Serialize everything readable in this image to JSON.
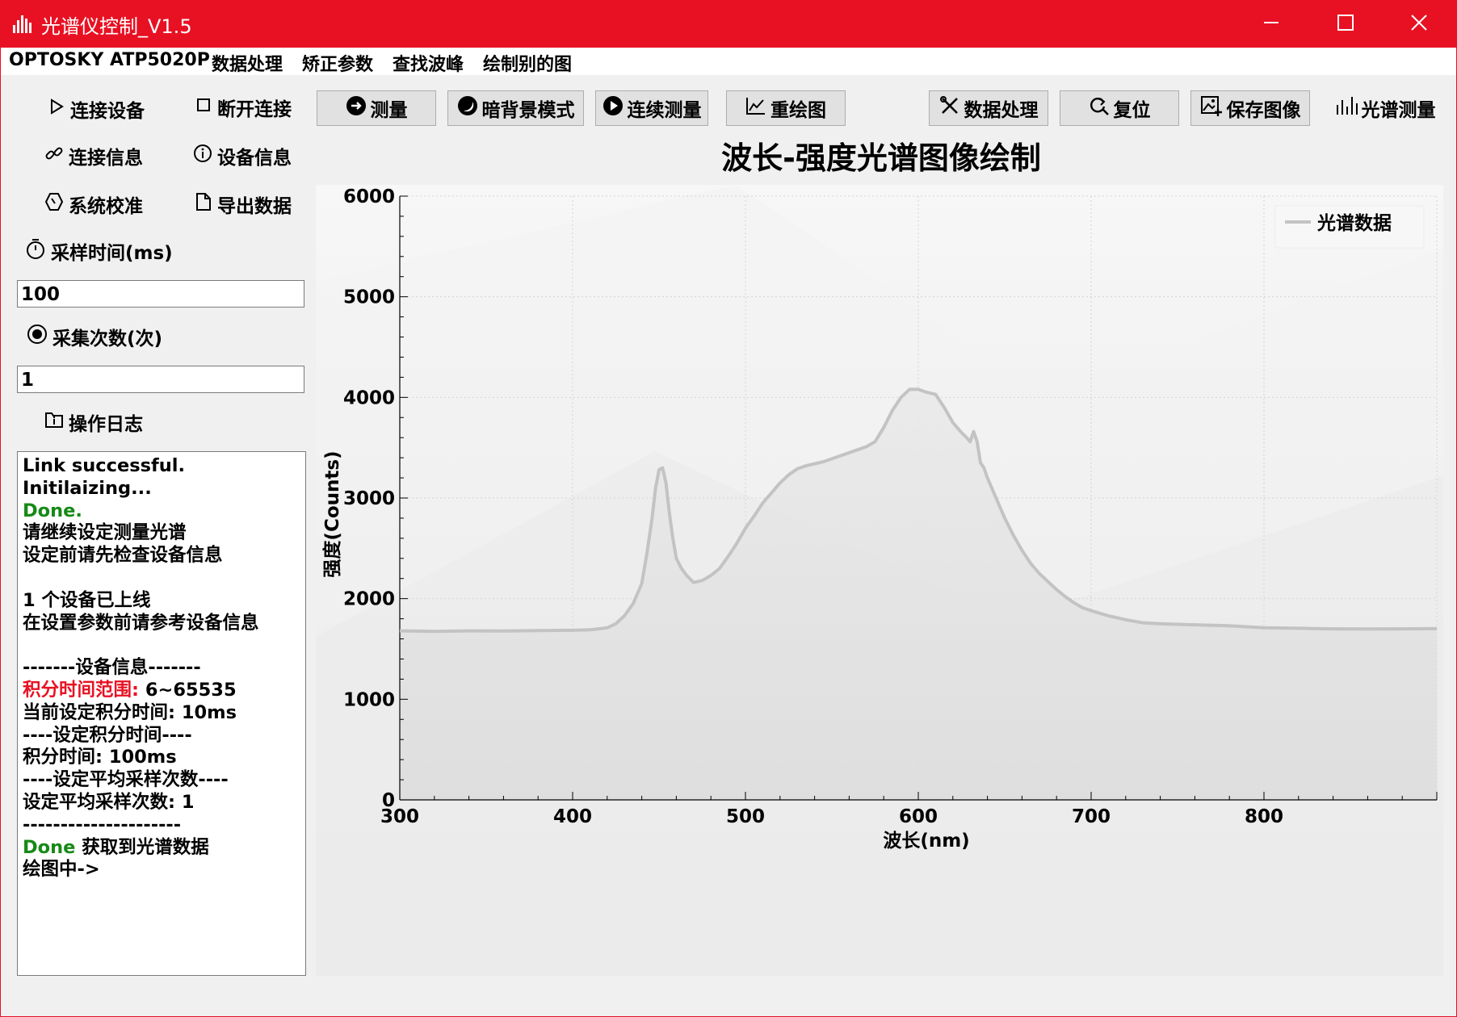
{
  "window": {
    "title": "光谱仪控制_V1.5",
    "accent": "#e81123",
    "controls": [
      "minimize-icon",
      "maximize-icon",
      "close-icon"
    ]
  },
  "menu": {
    "items": [
      "OPTOSKY ATP5020P",
      "数据处理",
      "矫正参数",
      "查找波峰",
      "绘制别的图"
    ]
  },
  "sidebar": {
    "connect": "连接设备",
    "disconnect": "断开连接",
    "link_info": "连接信息",
    "device_info": "设备信息",
    "calibrate": "系统校准",
    "export": "导出数据",
    "sample_time_label": "采样时间(ms)",
    "sample_time_value": "100",
    "sample_count_label": "采集次数(次)",
    "sample_count_value": "1",
    "log_label": "操作日志"
  },
  "log": {
    "lines": [
      {
        "text": "Link successful.",
        "color": "#000000"
      },
      {
        "text": "Initilaizing...",
        "color": "#000000"
      },
      {
        "text": "Done.",
        "color": "#168a16"
      },
      {
        "text": "请继续设定测量光谱",
        "color": "#000000"
      },
      {
        "text": "设定前请先检查设备信息",
        "color": "#000000"
      },
      {
        "text": "",
        "color": "#000000"
      },
      {
        "text": "1 个设备已上线",
        "color": "#000000"
      },
      {
        "text": "在设置参数前请参考设备信息",
        "color": "#000000"
      },
      {
        "text": "",
        "color": "#000000"
      },
      {
        "text": "-------设备信息-------",
        "color": "#000000"
      },
      {
        "prefix": "积分时间范围:",
        "prefix_color": "#e81123",
        "text": " 6~65535",
        "color": "#000000"
      },
      {
        "text": "当前设定积分时间: 10ms",
        "color": "#000000"
      },
      {
        "text": "----设定积分时间----",
        "color": "#000000"
      },
      {
        "text": "积分时间: 100ms",
        "color": "#000000"
      },
      {
        "text": "----设定平均采样次数----",
        "color": "#000000"
      },
      {
        "text": "设定平均采样次数: 1",
        "color": "#000000"
      },
      {
        "text": "---------------------",
        "color": "#000000"
      },
      {
        "prefix": "Done",
        "prefix_color": "#168a16",
        "text": " 获取到光谱数据",
        "color": "#000000"
      },
      {
        "text": "绘图中->",
        "color": "#000000"
      }
    ]
  },
  "toolbar": {
    "measure": "测量",
    "dark_mode": "暗背景模式",
    "continuous": "连续测量",
    "redraw": "重绘图",
    "data_process": "数据处理",
    "reset": "复位",
    "save_image": "保存图像",
    "spectrum_measure": "光谱测量"
  },
  "chart_data": {
    "type": "line",
    "title": "波长-强度光谱图像绘制",
    "xlabel": "波长(nm)",
    "ylabel": "强度(Counts)",
    "xlim": [
      300,
      900
    ],
    "ylim": [
      0,
      6000
    ],
    "xticks": [
      300,
      400,
      500,
      600,
      700,
      800
    ],
    "yticks": [
      0,
      1000,
      2000,
      3000,
      4000,
      5000,
      6000
    ],
    "grid": true,
    "legend_position": "top-right",
    "line_color": "#c3c3c3",
    "series": [
      {
        "name": "光谱数据",
        "x": [
          300,
          320,
          340,
          360,
          380,
          400,
          410,
          420,
          425,
          430,
          435,
          440,
          443,
          446,
          448,
          450,
          452,
          454,
          456,
          458,
          460,
          463,
          466,
          470,
          475,
          480,
          485,
          490,
          495,
          500,
          505,
          510,
          515,
          520,
          525,
          530,
          535,
          540,
          545,
          550,
          555,
          560,
          565,
          570,
          575,
          580,
          585,
          590,
          595,
          600,
          605,
          610,
          615,
          620,
          625,
          628,
          630,
          632,
          634,
          636,
          638,
          640,
          645,
          650,
          655,
          660,
          665,
          670,
          675,
          680,
          685,
          690,
          695,
          700,
          710,
          720,
          730,
          740,
          750,
          760,
          780,
          800,
          820,
          840,
          860,
          880,
          900
        ],
        "y": [
          1680,
          1675,
          1680,
          1678,
          1683,
          1685,
          1690,
          1710,
          1750,
          1830,
          1950,
          2150,
          2450,
          2800,
          3100,
          3280,
          3300,
          3150,
          2850,
          2600,
          2400,
          2300,
          2230,
          2160,
          2180,
          2230,
          2300,
          2420,
          2550,
          2700,
          2820,
          2950,
          3050,
          3150,
          3230,
          3290,
          3320,
          3340,
          3360,
          3390,
          3420,
          3450,
          3480,
          3510,
          3560,
          3700,
          3870,
          4000,
          4080,
          4080,
          4050,
          4030,
          3900,
          3750,
          3650,
          3600,
          3560,
          3660,
          3560,
          3350,
          3300,
          3200,
          3000,
          2800,
          2630,
          2480,
          2350,
          2250,
          2170,
          2090,
          2020,
          1960,
          1910,
          1880,
          1830,
          1790,
          1760,
          1750,
          1745,
          1740,
          1730,
          1710,
          1705,
          1700,
          1698,
          1700,
          1702
        ]
      }
    ]
  }
}
